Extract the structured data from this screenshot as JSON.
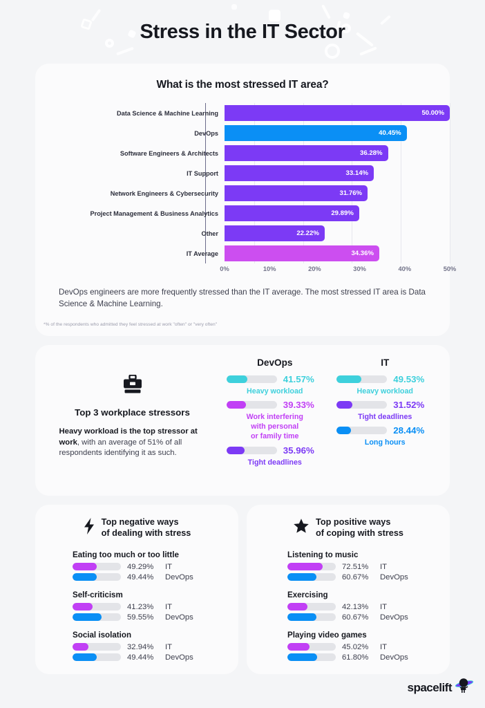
{
  "title": "Stress in the IT Sector",
  "chart_card": {
    "title": "What is the most stressed IT area?",
    "caption": "DevOps engineers are more frequently stressed than the IT average. The most stressed IT area is Data Science & Machine Learning.",
    "footnote": "*% of the respondents who admitted they feel stressed at work \"often\" or \"very often\""
  },
  "chart_data": {
    "type": "bar",
    "orientation": "horizontal",
    "title": "What is the most stressed IT area?",
    "xlabel": "",
    "ylabel": "",
    "xlim": [
      0,
      50
    ],
    "xticks": [
      "0%",
      "10%",
      "20%",
      "30%",
      "40%",
      "50%"
    ],
    "xtick_values": [
      0,
      10,
      20,
      30,
      40,
      50
    ],
    "grid": true,
    "legend": "none",
    "categories": [
      "Data Science & Machine Learning",
      "DevOps",
      "Software Engineers & Architects",
      "IT Support",
      "Network Engineers & Cybersecurity",
      "Project Management & Business Analytics",
      "Other",
      "IT Average"
    ],
    "values": [
      50.0,
      40.45,
      36.28,
      33.14,
      31.76,
      29.89,
      22.22,
      34.36
    ],
    "labels": [
      "50.00%",
      "40.45%",
      "36.28%",
      "33.14%",
      "31.76%",
      "29.89%",
      "22.22%",
      "34.36%"
    ],
    "colors": [
      "#7C3AF5",
      "#0A8FF5",
      "#7C3AF5",
      "#7C3AF5",
      "#7C3AF5",
      "#7C3AF5",
      "#7C3AF5",
      "#CC4EF0"
    ]
  },
  "stressors": {
    "icon": "briefcase-icon",
    "heading": "Top 3 workplace stressors",
    "body_bold": "Heavy workload is the top stressor at work",
    "body_rest": ", with an average of 51% of all respondents identifying it as such.",
    "columns": [
      {
        "title": "DevOps",
        "items": [
          {
            "pct": "41.57%",
            "value": 41.57,
            "name": "Heavy workload",
            "color": "#3ED0DC"
          },
          {
            "pct": "39.33%",
            "value": 39.33,
            "name": "Work interfering\nwith personal\nor family time",
            "color": "#C13FF5"
          },
          {
            "pct": "35.96%",
            "value": 35.96,
            "name": "Tight deadlines",
            "color": "#7C3AF5"
          }
        ]
      },
      {
        "title": "IT",
        "items": [
          {
            "pct": "49.53%",
            "value": 49.53,
            "name": "Heavy workload",
            "color": "#3ED0DC"
          },
          {
            "pct": "31.52%",
            "value": 31.52,
            "name": "Tight deadlines",
            "color": "#7C3AF5"
          },
          {
            "pct": "28.44%",
            "value": 28.44,
            "name": "Long hours",
            "color": "#0A8FF5"
          }
        ]
      }
    ]
  },
  "bottom": {
    "negative": {
      "icon": "lightning-bolt-icon",
      "title_line1": "Top negative ways",
      "title_line2": "of dealing with stress",
      "groups": [
        {
          "title": "Eating too much or too little",
          "rows": [
            {
              "pct": "49.29%",
              "value": 49.29,
              "group": "IT",
              "color": "#C13FF5"
            },
            {
              "pct": "49.44%",
              "value": 49.44,
              "group": "DevOps",
              "color": "#0A8FF5"
            }
          ]
        },
        {
          "title": "Self-criticism",
          "rows": [
            {
              "pct": "41.23%",
              "value": 41.23,
              "group": "IT",
              "color": "#C13FF5"
            },
            {
              "pct": "59.55%",
              "value": 59.55,
              "group": "DevOps",
              "color": "#0A8FF5"
            }
          ]
        },
        {
          "title": "Social isolation",
          "rows": [
            {
              "pct": "32.94%",
              "value": 32.94,
              "group": "IT",
              "color": "#C13FF5"
            },
            {
              "pct": "49.44%",
              "value": 49.44,
              "group": "DevOps",
              "color": "#0A8FF5"
            }
          ]
        }
      ]
    },
    "positive": {
      "icon": "star-icon",
      "title_line1": "Top positive ways",
      "title_line2": "of coping with stress",
      "groups": [
        {
          "title": "Listening to music",
          "rows": [
            {
              "pct": "72.51%",
              "value": 72.51,
              "group": "IT",
              "color": "#C13FF5"
            },
            {
              "pct": "60.67%",
              "value": 60.67,
              "group": "DevOps",
              "color": "#0A8FF5"
            }
          ]
        },
        {
          "title": "Exercising",
          "rows": [
            {
              "pct": "42.13%",
              "value": 42.13,
              "group": "IT",
              "color": "#C13FF5"
            },
            {
              "pct": "60.67%",
              "value": 60.67,
              "group": "DevOps",
              "color": "#0A8FF5"
            }
          ]
        },
        {
          "title": "Playing video games",
          "rows": [
            {
              "pct": "45.02%",
              "value": 45.02,
              "group": "IT",
              "color": "#C13FF5"
            },
            {
              "pct": "61.80%",
              "value": 61.8,
              "group": "DevOps",
              "color": "#0A8FF5"
            }
          ]
        }
      ]
    }
  },
  "footer": {
    "logo_text": "spacelift",
    "logo_icon": "spacelift-astronaut-icon"
  },
  "colors": {
    "purple": "#7C3AF5",
    "blue": "#0A8FF5",
    "magenta": "#CC4EF0",
    "bright_magenta": "#C13FF5",
    "teal": "#3ED0DC",
    "page_bg": "#f4f5f7",
    "card_bg": "#fbfbfc"
  }
}
